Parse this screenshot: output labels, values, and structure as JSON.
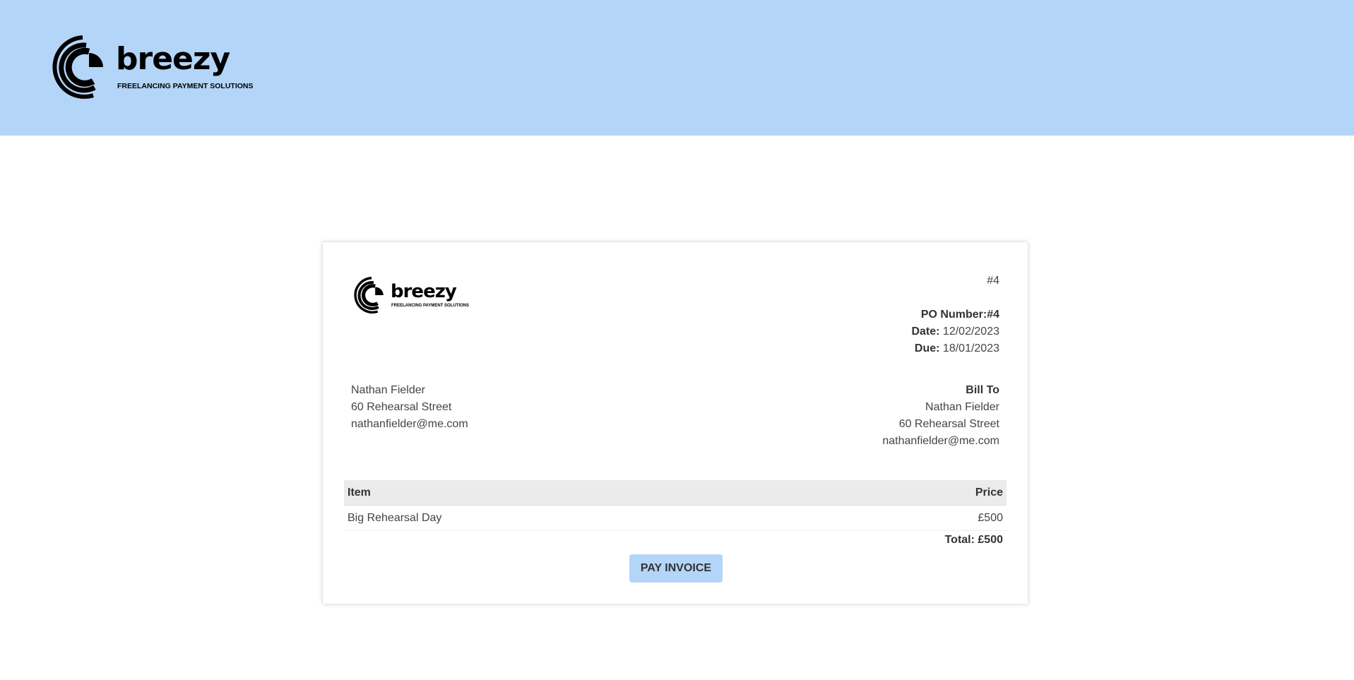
{
  "brand": {
    "name": "breezy",
    "tagline": "FREELANCING PAYMENT SOLUTIONS",
    "colors": {
      "header_bg": "#b3d5f8",
      "button_bg": "#b3d5f8"
    }
  },
  "invoice": {
    "number": "#4",
    "po_label": "PO Number:",
    "po_value": "#4",
    "date_label": "Date:",
    "date_value": "12/02/2023",
    "due_label": "Due:",
    "due_value": "18/01/2023",
    "from": {
      "name": "Nathan Fielder",
      "street": "60 Rehearsal Street",
      "email": "nathanfielder@me.com"
    },
    "bill_to": {
      "title": "Bill To",
      "name": "Nathan Fielder",
      "street": "60 Rehearsal Street",
      "email": "nathanfielder@me.com"
    },
    "table": {
      "headers": {
        "item": "Item",
        "price": "Price"
      },
      "rows": [
        {
          "item": "Big Rehearsal Day",
          "price": "£500"
        }
      ]
    },
    "total": "Total: £500",
    "pay_button": "PAY INVOICE"
  }
}
